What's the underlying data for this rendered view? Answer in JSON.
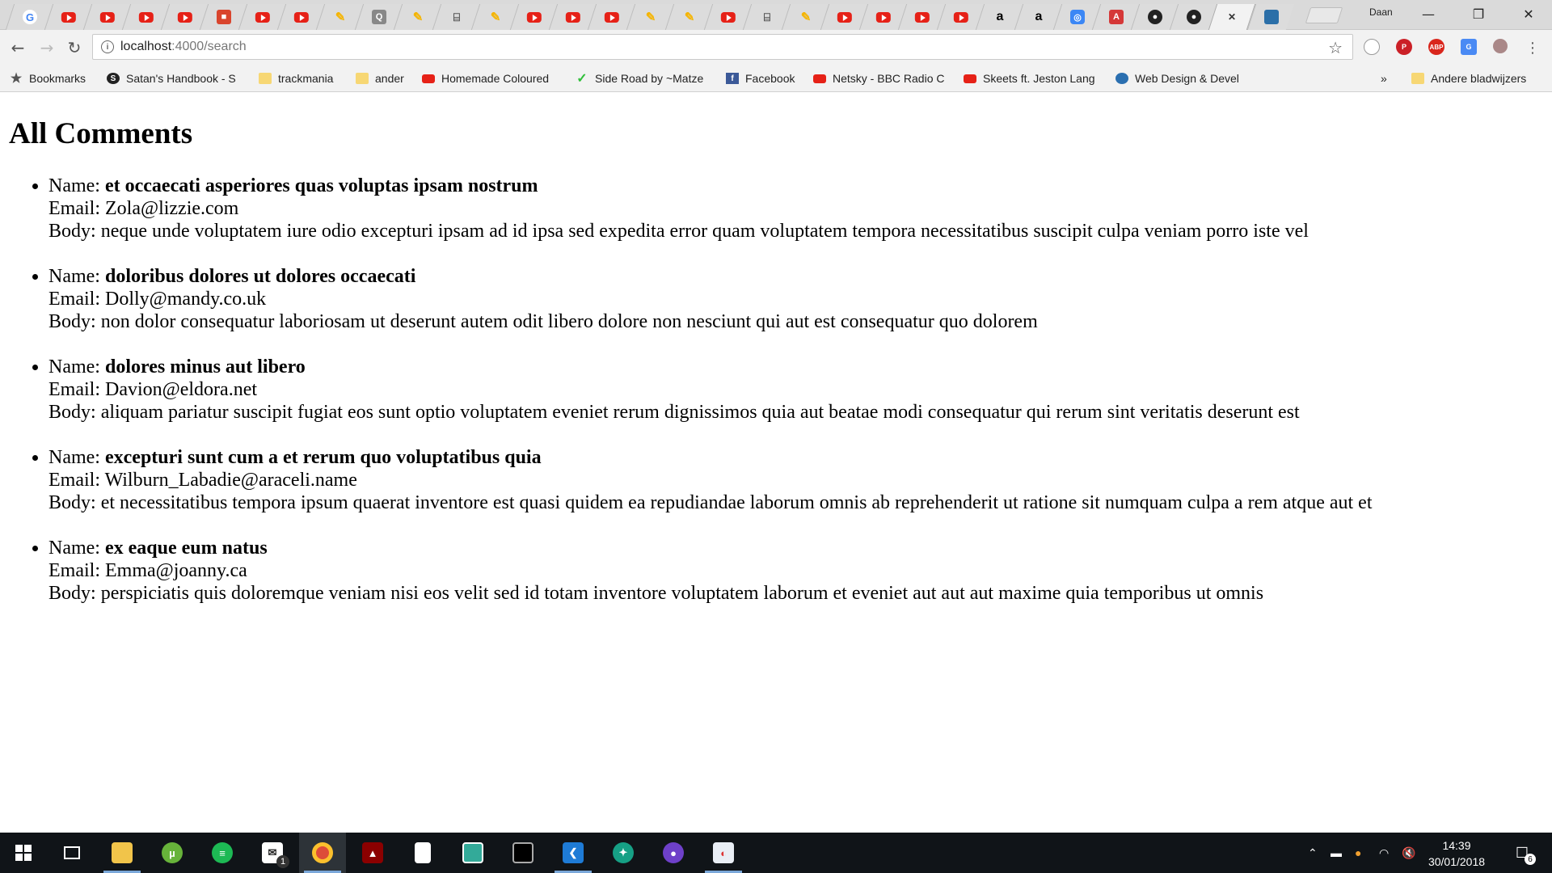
{
  "browser": {
    "profile_name": "Daan",
    "url_host": "localhost",
    "url_path": ":4000/search",
    "tabs": [
      {
        "icon": "google-icon",
        "glyph": "G"
      },
      {
        "icon": "youtube-icon",
        "glyph": ""
      },
      {
        "icon": "youtube-icon",
        "glyph": ""
      },
      {
        "icon": "youtube-icon",
        "glyph": ""
      },
      {
        "icon": "youtube-icon",
        "glyph": ""
      },
      {
        "icon": "shield-icon",
        "glyph": "■"
      },
      {
        "icon": "youtube-icon",
        "glyph": ""
      },
      {
        "icon": "youtube-icon",
        "glyph": ""
      },
      {
        "icon": "pen-icon",
        "glyph": "✎"
      },
      {
        "icon": "q-icon",
        "glyph": "Q"
      },
      {
        "icon": "pen-icon",
        "glyph": "✎"
      },
      {
        "icon": "book-icon",
        "glyph": "⌸"
      },
      {
        "icon": "pen-icon",
        "glyph": "✎"
      },
      {
        "icon": "youtube-icon",
        "glyph": ""
      },
      {
        "icon": "youtube-icon",
        "glyph": ""
      },
      {
        "icon": "youtube-icon",
        "glyph": ""
      },
      {
        "icon": "pen-icon",
        "glyph": "✎"
      },
      {
        "icon": "pen-icon",
        "glyph": "✎"
      },
      {
        "icon": "youtube-icon",
        "glyph": ""
      },
      {
        "icon": "book-icon",
        "glyph": "⌸"
      },
      {
        "icon": "pen-icon",
        "glyph": "✎"
      },
      {
        "icon": "youtube-icon",
        "glyph": ""
      },
      {
        "icon": "youtube-icon",
        "glyph": ""
      },
      {
        "icon": "youtube-icon",
        "glyph": ""
      },
      {
        "icon": "youtube-icon",
        "glyph": ""
      },
      {
        "icon": "amazon-icon",
        "glyph": "a"
      },
      {
        "icon": "amazon-icon",
        "glyph": "a"
      },
      {
        "icon": "circle-app-icon",
        "glyph": "◎"
      },
      {
        "icon": "angular-icon",
        "glyph": "A"
      },
      {
        "icon": "github-icon",
        "glyph": "●"
      },
      {
        "icon": "github-icon",
        "glyph": "●"
      }
    ],
    "active_tab_close": "✕"
  },
  "bookmarks": [
    {
      "label": "Bookmarks",
      "icon": "star-icon"
    },
    {
      "label": "Satan's Handbook - S",
      "icon": "shield-icon"
    },
    {
      "label": "trackmania",
      "icon": "folder-icon"
    },
    {
      "label": "ander",
      "icon": "folder-icon"
    },
    {
      "label": "Homemade Coloured",
      "icon": "youtube-icon"
    },
    {
      "label": "Side Road by ~Matze",
      "icon": "leaf-icon"
    },
    {
      "label": "Facebook",
      "icon": "facebook-icon"
    },
    {
      "label": "Netsky - BBC Radio C",
      "icon": "youtube-icon"
    },
    {
      "label": "Skeets ft. Jeston Lang",
      "icon": "youtube-icon"
    },
    {
      "label": "Web Design & Devel",
      "icon": "drop-icon"
    }
  ],
  "bookmarks_overflow": "»",
  "other_bookmarks": "Andere bladwijzers",
  "page": {
    "heading": "All Comments",
    "name_prefix": "Name: ",
    "email_prefix": "Email: ",
    "body_prefix": "Body: ",
    "comments": [
      {
        "name": "et occaecati asperiores quas voluptas ipsam nostrum",
        "email": "Zola@lizzie.com",
        "body": "neque unde voluptatem iure odio excepturi ipsam ad id ipsa sed expedita error quam voluptatem tempora necessitatibus suscipit culpa veniam porro iste vel"
      },
      {
        "name": "doloribus dolores ut dolores occaecati",
        "email": "Dolly@mandy.co.uk",
        "body": "non dolor consequatur laboriosam ut deserunt autem odit libero dolore non nesciunt qui aut est consequatur quo dolorem"
      },
      {
        "name": "dolores minus aut libero",
        "email": "Davion@eldora.net",
        "body": "aliquam pariatur suscipit fugiat eos sunt optio voluptatem eveniet rerum dignissimos quia aut beatae modi consequatur qui rerum sint veritatis deserunt est"
      },
      {
        "name": "excepturi sunt cum a et rerum quo voluptatibus quia",
        "email": "Wilburn_Labadie@araceli.name",
        "body": "et necessitatibus tempora ipsum quaerat inventore est quasi quidem ea repudiandae laborum omnis ab reprehenderit ut ratione sit numquam culpa a rem atque aut et"
      },
      {
        "name": "ex eaque eum natus",
        "email": "Emma@joanny.ca",
        "body": "perspiciatis quis doloremque veniam nisi eos velit sed id totam inventore voluptatem laborum et eveniet aut aut aut maxime quia temporibus ut omnis"
      }
    ]
  },
  "taskbar": {
    "mail_badge": "1",
    "time": "14:39",
    "date": "30/01/2018",
    "notification_count": "6"
  }
}
